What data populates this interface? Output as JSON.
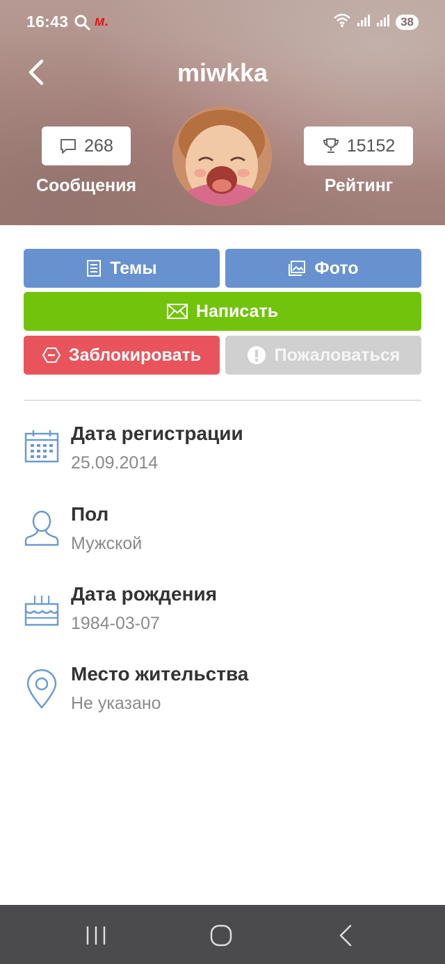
{
  "status": {
    "time": "16:43",
    "brand": "м.",
    "battery": "38"
  },
  "header": {
    "username": "miwkka",
    "messages_count": "268",
    "messages_label": "Сообщения",
    "rating_value": "15152",
    "rating_label": "Рейтинг"
  },
  "actions": {
    "themes": "Темы",
    "photo": "Фото",
    "write": "Написать",
    "block": "Заблокировать",
    "report": "Пожаловаться"
  },
  "profile_info": [
    {
      "label": "Дата регистрации",
      "value": "25.09.2014",
      "icon": "calendar-icon"
    },
    {
      "label": "Пол",
      "value": "Мужской",
      "icon": "person-icon"
    },
    {
      "label": "Дата рождения",
      "value": "1984-03-07",
      "icon": "birthday-cake-icon"
    },
    {
      "label": "Место жительства",
      "value": "Не указано",
      "icon": "location-pin-icon"
    }
  ],
  "colors": {
    "primary_blue": "#6792cf",
    "write_green": "#72c30b",
    "block_red": "#e9545c",
    "report_gray": "#d0d0d0",
    "icon_blue": "#6a9ad4"
  }
}
